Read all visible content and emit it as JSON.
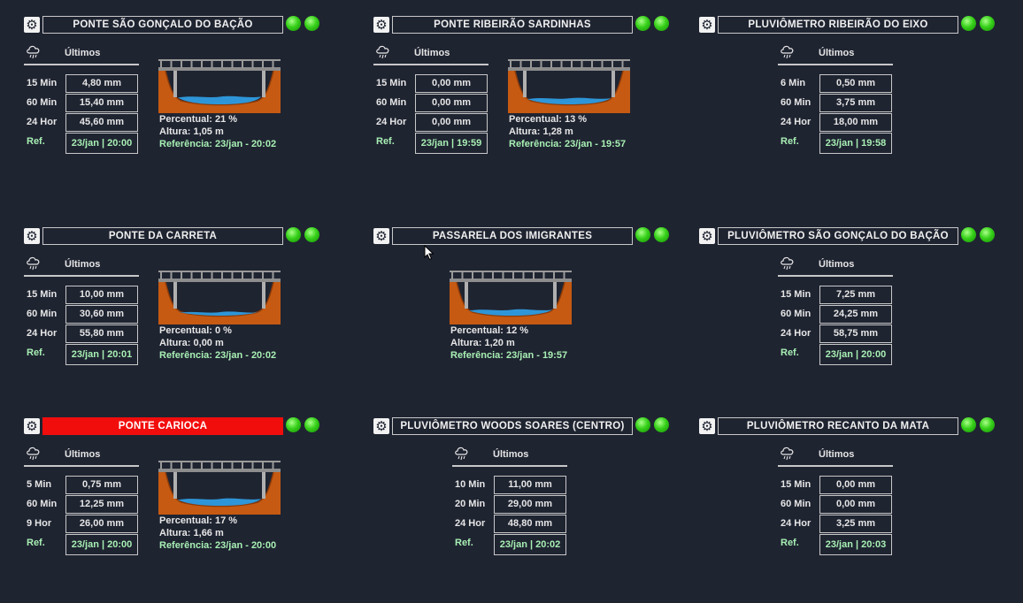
{
  "common": {
    "ultimos_label": "Últimos",
    "ref_label": "Ref.",
    "percentual_label": "Percentual:",
    "altura_label": "Altura:",
    "referencia_label": "Referência:",
    "gear_icon": "gear-icon",
    "rain_icon": "rain-cloud-icon",
    "status_color": "#2ecc1a",
    "alarm_color": "#f20d0d",
    "reference_color": "#a8f0b4"
  },
  "panels": [
    {
      "title": "PONTE SÃO GONÇALO DO BAÇÃO",
      "alarm": false,
      "rows": [
        {
          "label": "15 Min",
          "value": "4,80 mm"
        },
        {
          "label": "60 Min",
          "value": "15,40 mm"
        },
        {
          "label": "24 Hor",
          "value": "45,60 mm"
        }
      ],
      "ref": "23/jan | 20:00",
      "bridge": {
        "percentual": "21 %",
        "altura": "1,05 m",
        "referencia": "23/jan - 20:02",
        "level": 0.21
      }
    },
    {
      "title": "PONTE RIBEIRÃO SARDINHAS",
      "alarm": false,
      "rows": [
        {
          "label": "15 Min",
          "value": "0,00 mm"
        },
        {
          "label": "60 Min",
          "value": "0,00 mm"
        },
        {
          "label": "24 Hor",
          "value": "0,00 mm"
        }
      ],
      "ref": "23/jan | 19:59",
      "bridge": {
        "percentual": "13 %",
        "altura": "1,28 m",
        "referencia": "23/jan - 19:57",
        "level": 0.13
      }
    },
    {
      "title": "PLUVIÔMETRO RIBEIRÃO DO EIXO",
      "alarm": false,
      "rows": [
        {
          "label": "6 Min",
          "value": "0,50 mm"
        },
        {
          "label": "60 Min",
          "value": "3,75 mm"
        },
        {
          "label": "24 Hor",
          "value": "18,00 mm"
        }
      ],
      "ref": "23/jan | 19:58",
      "bridge": null
    },
    {
      "title": "PONTE DA CARRETA",
      "alarm": false,
      "rows": [
        {
          "label": "15 Min",
          "value": "10,00 mm"
        },
        {
          "label": "60 Min",
          "value": "30,60 mm"
        },
        {
          "label": "24 Hor",
          "value": "55,80 mm"
        }
      ],
      "ref": "23/jan | 20:01",
      "bridge": {
        "percentual": "0 %",
        "altura": "0,00 m",
        "referencia": "23/jan - 20:02",
        "level": 0.0
      }
    },
    {
      "title": "PASSARELA DOS IMIGRANTES",
      "alarm": false,
      "rows": null,
      "ref": null,
      "bridge": {
        "percentual": "12 %",
        "altura": "1,20 m",
        "referencia": "23/jan - 19:57",
        "level": 0.12
      }
    },
    {
      "title": "PLUVIÔMETRO SÃO GONÇALO DO BAÇÃO",
      "alarm": false,
      "rows": [
        {
          "label": "15 Min",
          "value": "7,25 mm"
        },
        {
          "label": "60 Min",
          "value": "24,25 mm"
        },
        {
          "label": "24 Hor",
          "value": "58,75 mm"
        }
      ],
      "ref": "23/jan | 20:00",
      "bridge": null
    },
    {
      "title": "PONTE CARIOCA",
      "alarm": true,
      "rows": [
        {
          "label": "5 Min",
          "value": "0,75 mm"
        },
        {
          "label": "60 Min",
          "value": "12,25 mm"
        },
        {
          "label": "9 Hor",
          "value": "26,00 mm"
        }
      ],
      "ref": "23/jan | 20:00",
      "bridge": {
        "percentual": "17 %",
        "altura": "1,66 m",
        "referencia": "23/jan - 20:00",
        "level": 0.17
      }
    },
    {
      "title": "PLUVIÔMETRO WOODS SOARES (CENTRO)",
      "alarm": false,
      "rows": [
        {
          "label": "10 Min",
          "value": "11,00 mm"
        },
        {
          "label": "20 Min",
          "value": "29,00 mm"
        },
        {
          "label": "24 Hor",
          "value": "48,80 mm"
        }
      ],
      "ref": "23/jan | 20:02",
      "bridge": null
    },
    {
      "title": "PLUVIÔMETRO RECANTO DA MATA",
      "alarm": false,
      "rows": [
        {
          "label": "15 Min",
          "value": "0,00 mm"
        },
        {
          "label": "60 Min",
          "value": "0,00 mm"
        },
        {
          "label": "24 Hor",
          "value": "3,25 mm"
        }
      ],
      "ref": "23/jan | 20:03",
      "bridge": null
    }
  ]
}
